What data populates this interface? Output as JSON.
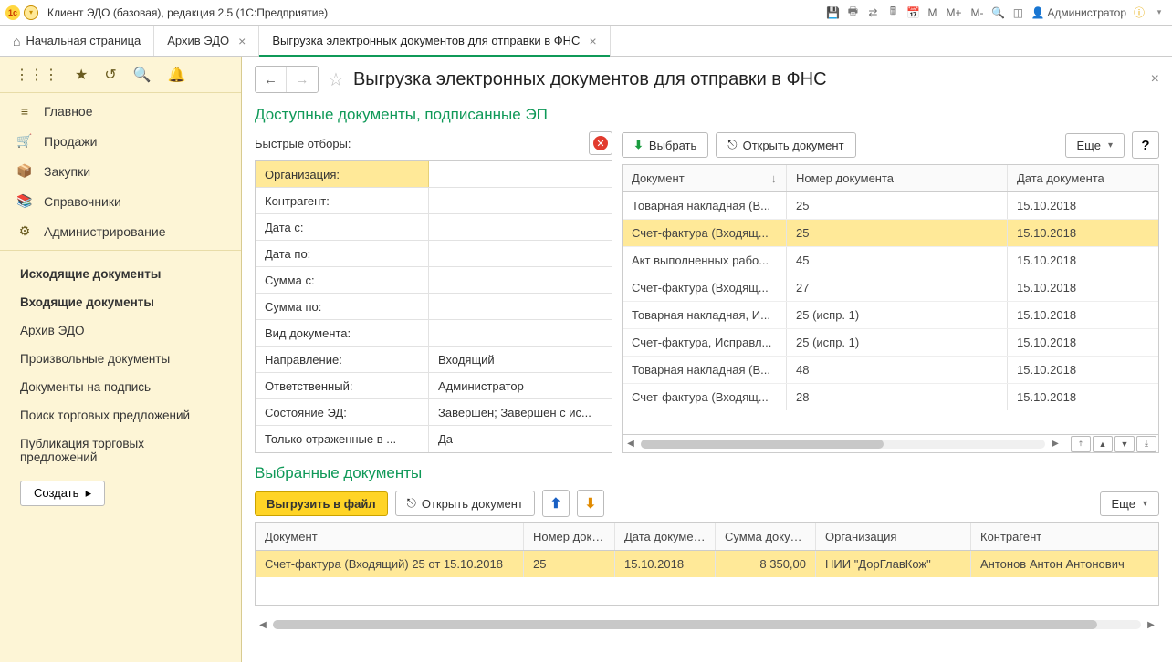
{
  "mainbar": {
    "title": "Клиент ЭДО (базовая), редакция 2.5  (1С:Предприятие)",
    "user": "Администратор",
    "m": "M",
    "mplus": "M+",
    "mminus": "M-"
  },
  "tabs": {
    "home": "Начальная страница",
    "archive": "Архив ЭДО",
    "export": "Выгрузка электронных документов для отправки в ФНС"
  },
  "sidebar": {
    "nav": {
      "main": "Главное",
      "sales": "Продажи",
      "purch": "Закупки",
      "ref": "Справочники",
      "admin": "Администрирование"
    },
    "links": {
      "outgoing": "Исходящие документы",
      "incoming": "Входящие документы",
      "archive": "Архив ЭДО",
      "arbitrary": "Произвольные документы",
      "tosign": "Документы на подпись",
      "offers_search": "Поиск торговых предложений",
      "offers_pub": "Публикация торговых предложений"
    },
    "create": "Создать"
  },
  "page": {
    "title": "Выгрузка электронных документов для отправки в ФНС",
    "section1": "Доступные документы, подписанные ЭП",
    "quick_filters": "Быстрые отборы:",
    "section2": "Выбранные документы"
  },
  "buttons": {
    "select": "Выбрать",
    "open_doc": "Открыть документ",
    "more": "Еще",
    "help": "?",
    "export_file": "Выгрузить в файл"
  },
  "filters": [
    {
      "label": "Организация:",
      "value": "",
      "sel": true
    },
    {
      "label": "Контрагент:",
      "value": ""
    },
    {
      "label": "Дата с:",
      "value": ""
    },
    {
      "label": "Дата по:",
      "value": ""
    },
    {
      "label": "Сумма с:",
      "value": ""
    },
    {
      "label": "Сумма по:",
      "value": ""
    },
    {
      "label": "Вид документа:",
      "value": ""
    },
    {
      "label": "Направление:",
      "value": "Входящий"
    },
    {
      "label": "Ответственный:",
      "value": "Администратор"
    },
    {
      "label": "Состояние ЭД:",
      "value": "Завершен; Завершен с ис..."
    },
    {
      "label": "Только отраженные в ...",
      "value": "Да"
    }
  ],
  "grid1": {
    "headers": {
      "doc": "Документ",
      "num": "Номер документа",
      "date": "Дата документа"
    },
    "rows": [
      {
        "doc": "Товарная накладная (В...",
        "num": "25",
        "date": "15.10.2018"
      },
      {
        "doc": "Счет-фактура (Входящ...",
        "num": "25",
        "date": "15.10.2018",
        "sel": true
      },
      {
        "doc": "Акт выполненных рабо...",
        "num": "45",
        "date": "15.10.2018"
      },
      {
        "doc": "Счет-фактура (Входящ...",
        "num": "27",
        "date": "15.10.2018"
      },
      {
        "doc": "Товарная накладная, И...",
        "num": "25 (испр. 1)",
        "date": "15.10.2018"
      },
      {
        "doc": "Счет-фактура, Исправл...",
        "num": "25 (испр. 1)",
        "date": "15.10.2018"
      },
      {
        "doc": "Товарная накладная (В...",
        "num": "48",
        "date": "15.10.2018"
      },
      {
        "doc": "Счет-фактура (Входящ...",
        "num": "28",
        "date": "15.10.2018"
      }
    ]
  },
  "grid2": {
    "headers": {
      "doc": "Документ",
      "num": "Номер документа",
      "date": "Дата документа",
      "sum": "Сумма документа",
      "org": "Организация",
      "kontr": "Контрагент"
    },
    "rows": [
      {
        "doc": "Счет-фактура (Входящий) 25 от 15.10.2018",
        "num": "25",
        "date": "15.10.2018",
        "sum": "8 350,00",
        "org": "НИИ \"ДорГлавКож\"",
        "kontr": "Антонов Антон Антонович",
        "sel": true
      }
    ]
  }
}
